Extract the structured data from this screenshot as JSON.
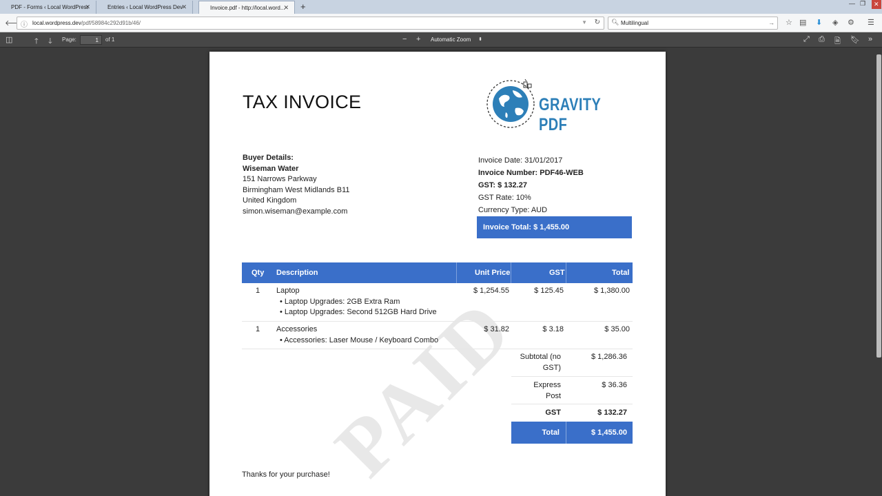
{
  "browser": {
    "tabs": [
      {
        "label": "PDF - Forms ‹ Local WordPress ..."
      },
      {
        "label": "Entries ‹ Local WordPress Dev ..."
      },
      {
        "label": "Invoice.pdf - http://local.word..."
      }
    ],
    "new_tab": "+",
    "url_host": "local.wordpress.dev",
    "url_path": "/pdf/58984c292d91b/46/",
    "search_value": "Multilingual"
  },
  "pdf_toolbar": {
    "page_label": "Page:",
    "page_value": "1",
    "page_total": "of 1",
    "zoom_out": "−",
    "zoom_in": "+",
    "zoom_value": "Automatic Zoom"
  },
  "invoice": {
    "title": "TAX INVOICE",
    "logo_text": "GRAVITY PDF",
    "buyer": {
      "heading": "Buyer Details:",
      "name": "Wiseman Water",
      "address1": "151 Narrows Parkway",
      "address2": "Birmingham West Midlands B11",
      "country": "United Kingdom",
      "email": "simon.wiseman@example.com"
    },
    "meta": {
      "date": "Invoice Date: 31/01/2017",
      "number": "Invoice Number: PDF46-WEB",
      "gst": "GST: $ 132.27",
      "gst_rate": "GST Rate: 10%",
      "currency": "Currency Type: AUD",
      "total": "Invoice Total: $ 1,455.00"
    },
    "columns": {
      "qty": "Qty",
      "description": "Description",
      "unit_price": "Unit Price",
      "gst": "GST",
      "total": "Total"
    },
    "rows": [
      {
        "qty": "1",
        "description": "Laptop",
        "options": [
          "• Laptop Upgrades: 2GB Extra Ram",
          "• Laptop Upgrades: Second 512GB Hard Drive"
        ],
        "unit_price": "$ 1,254.55",
        "gst": "$ 125.45",
        "total": "$ 1,380.00"
      },
      {
        "qty": "1",
        "description": "Accessories",
        "options": [
          "• Accessories: Laser Mouse / Keyboard Combo"
        ],
        "unit_price": "$ 31.82",
        "gst": "$ 3.18",
        "total": "$ 35.00"
      }
    ],
    "totals": {
      "subtotal_label_1": "Subtotal (no",
      "subtotal_label_2": "GST)",
      "subtotal_value": "$ 1,286.36",
      "shipping_label_1": "Express",
      "shipping_label_2": "Post",
      "shipping_value": "$ 36.36",
      "gst_label": "GST",
      "gst_value": "$ 132.27",
      "total_label": "Total",
      "total_value": "$ 1,455.00"
    },
    "thanks": "Thanks for your purchase!",
    "watermark": "PAID"
  },
  "colors": {
    "accent": "#3a6fc9",
    "logo": "#2d7fb8",
    "viewer_bg": "#3b3b3b"
  }
}
